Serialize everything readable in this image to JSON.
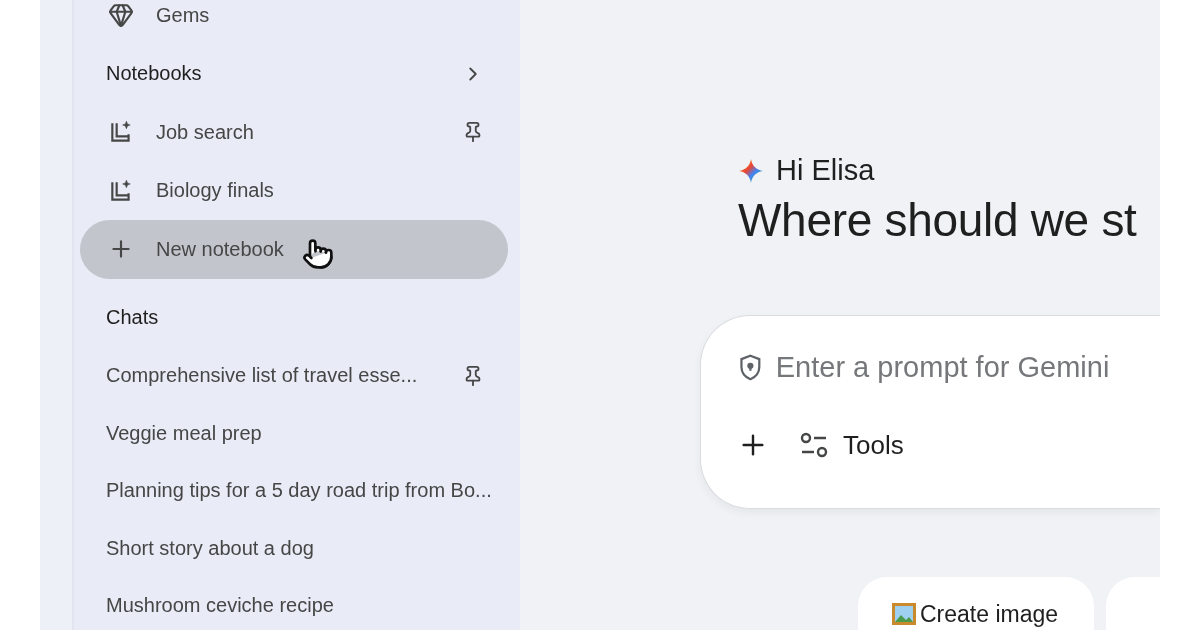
{
  "sidebar": {
    "top_items": [
      {
        "label": "Gems"
      }
    ],
    "notebooks": {
      "title": "Notebooks",
      "items": [
        {
          "kind": "notebook",
          "label": "Job search",
          "pinned": true,
          "hovered": false
        },
        {
          "kind": "notebook",
          "label": "Biology finals",
          "pinned": false,
          "hovered": false
        },
        {
          "kind": "new",
          "label": "New notebook",
          "pinned": false,
          "hovered": true
        }
      ]
    },
    "chats": {
      "title": "Chats",
      "items": [
        {
          "label": "Comprehensive list of travel esse...",
          "pinned": true
        },
        {
          "label": "Veggie meal prep",
          "pinned": false
        },
        {
          "label": "Planning tips for a 5 day road trip from Bo...",
          "pinned": false
        },
        {
          "label": "Short story about a dog",
          "pinned": false
        },
        {
          "label": "Mushroom ceviche recipe",
          "pinned": false
        }
      ]
    }
  },
  "main": {
    "greeting": "Hi Elisa",
    "heading": "Where should we st",
    "prompt": {
      "placeholder": "Enter a prompt for Gemini",
      "tools_label": "Tools"
    },
    "chips": [
      {
        "label": "Create image"
      }
    ]
  }
}
